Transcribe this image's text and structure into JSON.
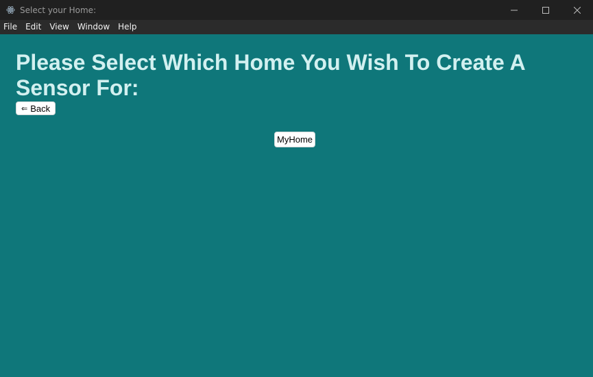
{
  "window": {
    "title": "Select your Home:"
  },
  "menu": {
    "items": [
      "File",
      "Edit",
      "View",
      "Window",
      "Help"
    ]
  },
  "page": {
    "title": "Please Select Which Home You Wish To Create A Sensor For:",
    "back_label": "Back",
    "back_icon": "left-arrow-icon",
    "homes": [
      "MyHome"
    ]
  },
  "colors": {
    "background": "#0f777a",
    "title_text": "#d2f0f0",
    "titlebar": "#202020",
    "menubar": "#2b2b2b"
  }
}
